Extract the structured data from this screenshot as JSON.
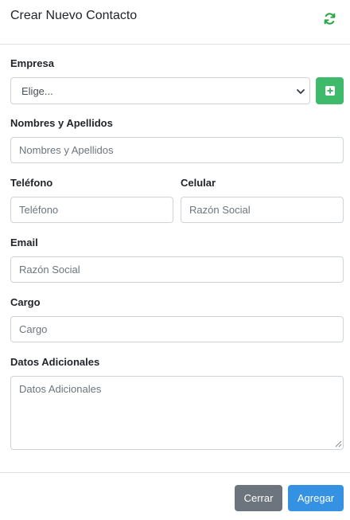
{
  "header": {
    "title": "Crear Nuevo Contacto",
    "refresh_icon": "refresh-icon",
    "refresh_color": "#28a745"
  },
  "form": {
    "empresa": {
      "label": "Empresa",
      "selected": "Elige..."
    },
    "add_company_color": "#3dbb6a",
    "nombres": {
      "label": "Nombres y Apellidos",
      "placeholder": "Nombres y Apellidos"
    },
    "telefono": {
      "label": "Teléfono",
      "placeholder": "Teléfono"
    },
    "celular": {
      "label": "Celular",
      "placeholder": "Razón Social"
    },
    "email": {
      "label": "Email",
      "placeholder": "Razón Social"
    },
    "cargo": {
      "label": "Cargo",
      "placeholder": "Cargo"
    },
    "datos": {
      "label": "Datos Adicionales",
      "placeholder": "Datos Adicionales"
    }
  },
  "footer": {
    "close_label": "Cerrar",
    "submit_label": "Agregar",
    "close_color": "#6c757d",
    "submit_color": "#3592e2"
  }
}
